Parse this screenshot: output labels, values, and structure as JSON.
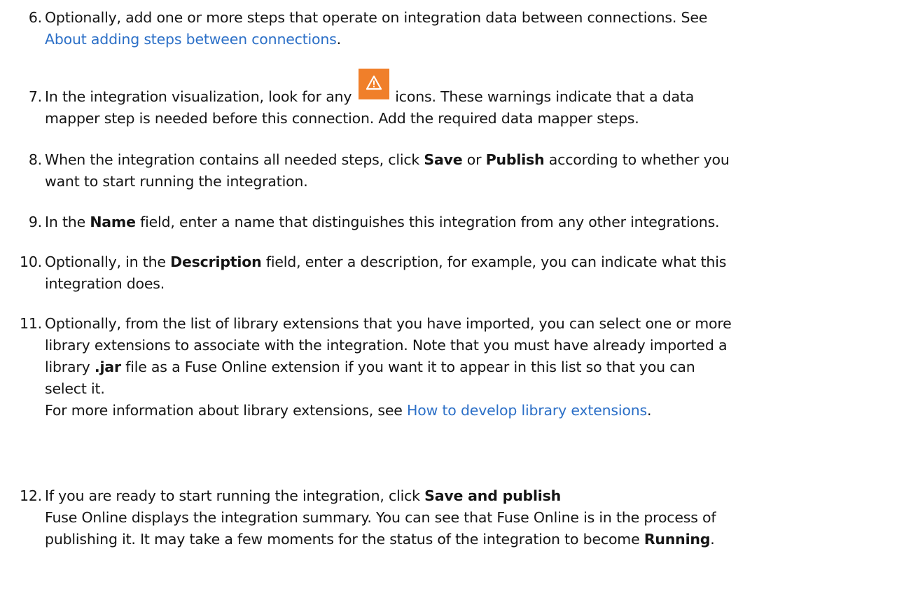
{
  "steps": [
    {
      "num": "6.",
      "text_a": "Optionally, add one or more steps that operate on integration data between connections. See",
      "link": "About adding steps between connections",
      "text_b": "."
    },
    {
      "num": "7.",
      "text_a": "In the integration visualization, look for any",
      "icon": "warning-icon",
      "text_b": "icons. These warnings indicate that a data",
      "text_c": "mapper step is needed before this connection. Add the required data mapper steps."
    },
    {
      "num": "8.",
      "text_a": "When the integration contains all needed steps, click",
      "kw1": "Save",
      "text_b": "or",
      "kw2": "Publish",
      "text_c": "according to whether you",
      "text_d": "want to start running the integration."
    },
    {
      "num": "9.",
      "text_a": "In the",
      "kw1": "Name",
      "text_b": "field, enter a name that distinguishes this integration from any other integrations."
    },
    {
      "num": "10.",
      "text_a": "Optionally, in the",
      "kw1": "Description",
      "text_b": "field, enter a description, for example, you can indicate what this",
      "text_c": "integration does."
    },
    {
      "num": "11.",
      "text_a": "Optionally, from the list of library extensions that you have imported, you can select one or more",
      "text_b": "library extensions to associate with the integration. Note that you must have already imported a",
      "text_c": "library",
      "kw1": ".jar",
      "text_d": "file as a Fuse Online extension if you want it to appear in this list so that you can",
      "text_e": "select it.",
      "text_f": "For more information about library extensions, see",
      "link": "How to develop library extensions",
      "text_g": "."
    },
    {
      "num": "12.",
      "text_a": "If you are ready to start running the integration, click",
      "kw1": "Save and publish",
      "text_b": "Fuse Online displays the integration summary. You can see that Fuse Online is in the process of",
      "text_c": "publishing it. It may take a few moments for the status of the integration to become",
      "kw2": "Running",
      "text_d": "."
    }
  ],
  "colors": {
    "link": "#2b6fc7",
    "warning_icon_bg": "#f07f2a"
  }
}
